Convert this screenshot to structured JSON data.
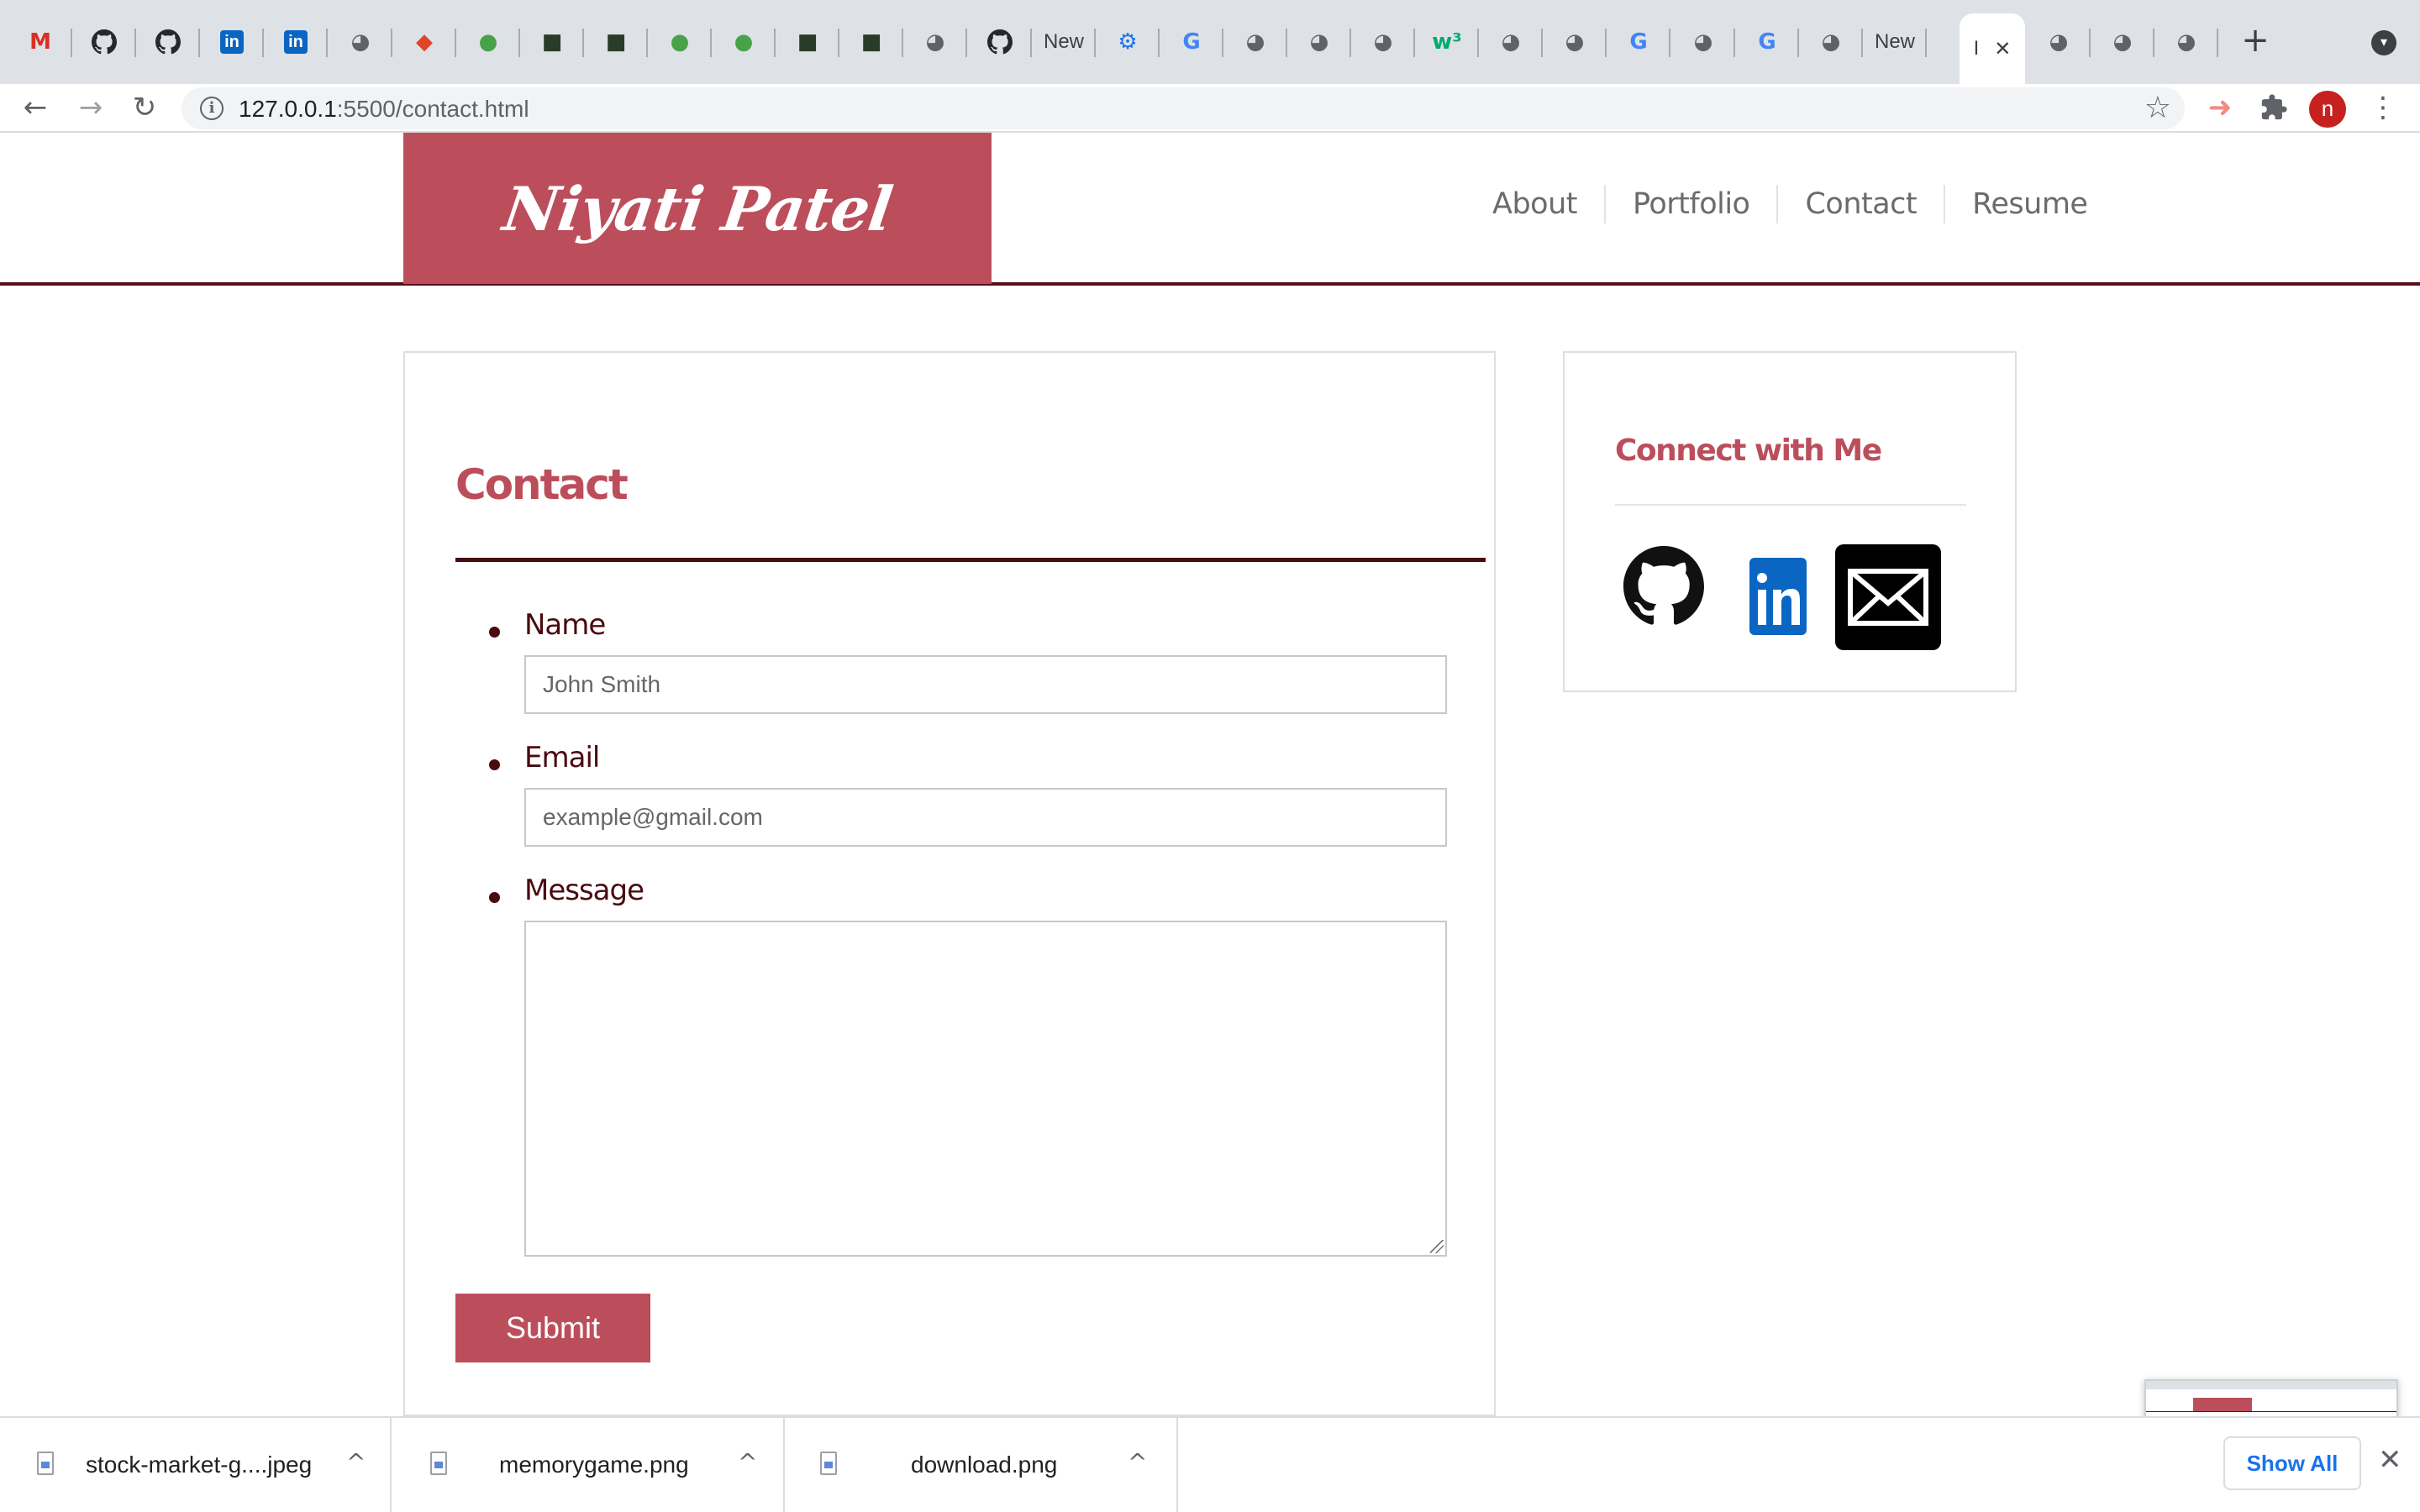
{
  "browser": {
    "tabs": [
      {
        "icon": "gmail-icon",
        "glyph": "M",
        "color": "#d93025"
      },
      {
        "icon": "github-icon",
        "glyph": "",
        "color": "#24292e"
      },
      {
        "icon": "github-icon",
        "glyph": "",
        "color": "#24292e"
      },
      {
        "icon": "linkedin-icon",
        "glyph": "in",
        "color": "#0a66c2"
      },
      {
        "icon": "linkedin-icon",
        "glyph": "in",
        "color": "#0a66c2"
      },
      {
        "icon": "globe-icon",
        "glyph": "◕",
        "color": "#5f6368"
      },
      {
        "icon": "gitlab-icon",
        "glyph": "◆",
        "color": "#e24329"
      },
      {
        "icon": "mongodb-leaf-icon",
        "glyph": "●",
        "color": "#47a248"
      },
      {
        "icon": "mongodb-icon",
        "glyph": "■",
        "color": "#2a3b2a"
      },
      {
        "icon": "mongodb-icon",
        "glyph": "■",
        "color": "#2a3b2a"
      },
      {
        "icon": "mongodb-leaf-icon",
        "glyph": "●",
        "color": "#47a248"
      },
      {
        "icon": "mongodb-leaf-icon",
        "glyph": "●",
        "color": "#47a248"
      },
      {
        "icon": "mongodb-icon",
        "glyph": "■",
        "color": "#2a3b2a"
      },
      {
        "icon": "mongodb-icon",
        "glyph": "■",
        "color": "#2a3b2a"
      },
      {
        "icon": "globe-icon",
        "glyph": "◕",
        "color": "#5f6368"
      },
      {
        "icon": "github-icon",
        "glyph": "",
        "color": "#24292e"
      },
      {
        "icon": "new-tab-label",
        "glyph": "New",
        "color": "#3c4043"
      },
      {
        "icon": "settings-gear-icon",
        "glyph": "⚙",
        "color": "#1a73e8"
      },
      {
        "icon": "google-icon",
        "glyph": "G",
        "color": "#4285f4"
      },
      {
        "icon": "globe-icon",
        "glyph": "◕",
        "color": "#5f6368"
      },
      {
        "icon": "globe-icon",
        "glyph": "◕",
        "color": "#5f6368"
      },
      {
        "icon": "globe-icon",
        "glyph": "◕",
        "color": "#5f6368"
      },
      {
        "icon": "w3schools-icon",
        "glyph": "w³",
        "color": "#04aa6d"
      },
      {
        "icon": "globe-icon",
        "glyph": "◕",
        "color": "#5f6368"
      },
      {
        "icon": "globe-icon",
        "glyph": "◕",
        "color": "#5f6368"
      },
      {
        "icon": "google-icon",
        "glyph": "G",
        "color": "#4285f4"
      },
      {
        "icon": "globe-icon",
        "glyph": "◕",
        "color": "#5f6368"
      },
      {
        "icon": "google-icon",
        "glyph": "G",
        "color": "#4285f4"
      },
      {
        "icon": "globe-icon",
        "glyph": "◕",
        "color": "#5f6368"
      },
      {
        "icon": "new-tab-label",
        "glyph": "New",
        "color": "#3c4043"
      }
    ],
    "active_tab": {
      "label": "I",
      "close": "✕"
    },
    "tabs_after": [
      {
        "icon": "globe-icon",
        "glyph": "◕",
        "color": "#5f6368"
      },
      {
        "icon": "globe-icon",
        "glyph": "◕",
        "color": "#5f6368"
      },
      {
        "icon": "globe-icon",
        "glyph": "◕",
        "color": "#5f6368"
      }
    ],
    "new_tab_symbol": "+",
    "tab_list_symbol": "▾",
    "back": "←",
    "forward": "→",
    "reload": "↻",
    "url_host": "127.0.0.1",
    "url_rest": ":5500/contact.html",
    "bookmark_star": "☆",
    "extension_icon": "puzzle-icon",
    "profile_initial": "n",
    "menu": "⋮",
    "cast_icon": "➜"
  },
  "site": {
    "logo": "Niyati Patel",
    "nav": [
      "About",
      "Portfolio",
      "Contact",
      "Resume"
    ],
    "contact": {
      "title": "Contact",
      "fields": {
        "name_label": "Name",
        "name_placeholder": "John Smith",
        "email_label": "Email",
        "email_placeholder": "example@gmail.com",
        "message_label": "Message"
      },
      "submit": "Submit"
    },
    "connect": {
      "title": "Connect with Me",
      "links": [
        "github-icon",
        "linkedin-icon",
        "email-icon"
      ]
    }
  },
  "downloads": {
    "items": [
      {
        "name": "stock-market-g....jpeg"
      },
      {
        "name": "memorygame.png"
      },
      {
        "name": "download.png"
      }
    ],
    "show_all": "Show All",
    "close": "✕",
    "chevron": "^"
  },
  "colors": {
    "brand": "#bc4e5c",
    "dark_accent": "#4a0a10",
    "link_blue": "#1a73e8"
  }
}
